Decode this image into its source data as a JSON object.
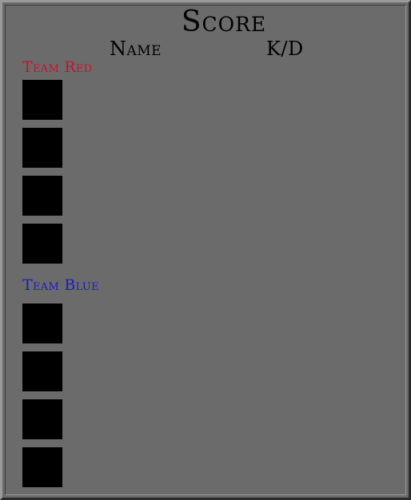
{
  "scoreboard": {
    "title": "Score",
    "columns": {
      "name": "Name",
      "kd": "K/D"
    },
    "teams": [
      {
        "label": "Team Red",
        "color": "#c8102e",
        "slots": 4
      },
      {
        "label": "Team Blue",
        "color": "#1a1ad0",
        "slots": 4
      }
    ]
  },
  "colors": {
    "background": "#6b6b6b",
    "slot": "#000000"
  }
}
